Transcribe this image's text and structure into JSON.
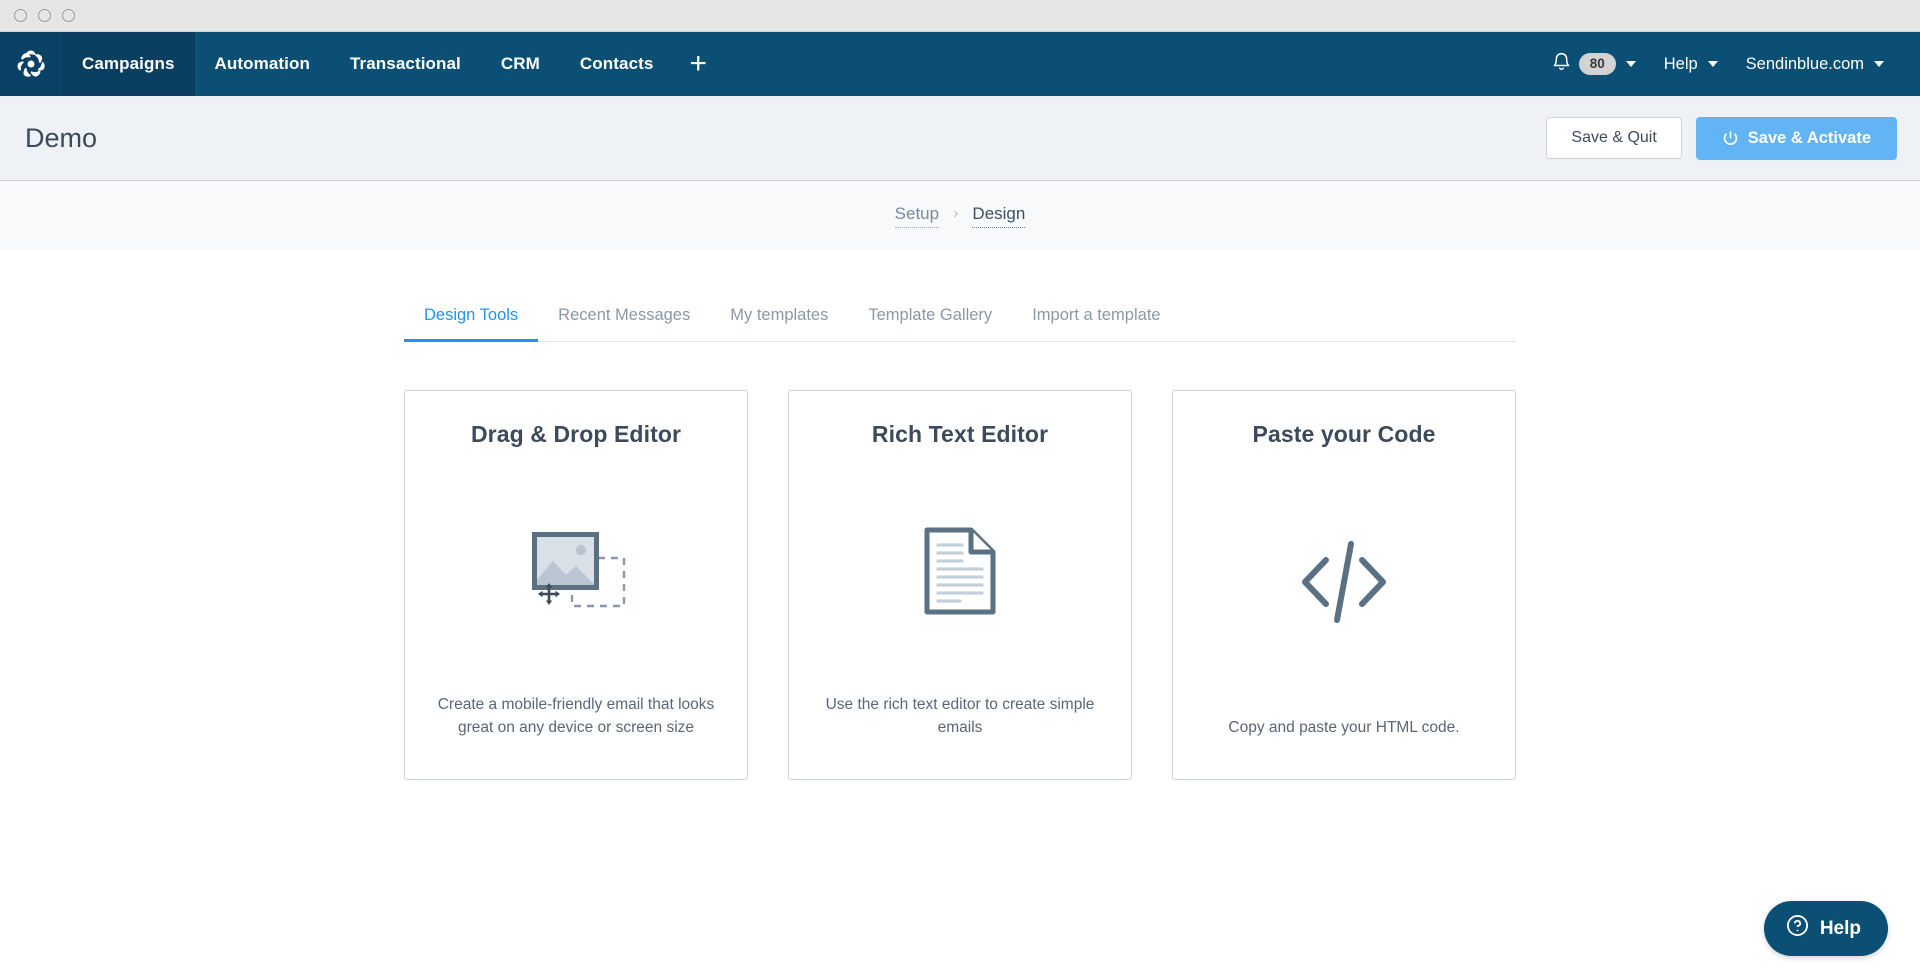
{
  "window": {
    "dots": [
      "close-dot",
      "minimize-dot",
      "maximize-dot"
    ]
  },
  "navbar": {
    "logo_name": "sendinblue-logo",
    "items": [
      {
        "label": "Campaigns",
        "active": true
      },
      {
        "label": "Automation",
        "active": false
      },
      {
        "label": "Transactional",
        "active": false
      },
      {
        "label": "CRM",
        "active": false
      },
      {
        "label": "Contacts",
        "active": false
      }
    ],
    "add_label": "+",
    "notifications": {
      "icon": "bell-icon",
      "count": "80"
    },
    "help_label": "Help",
    "account_label": "Sendinblue.com",
    "bg_color": "#0b4f74",
    "active_bg_color": "#0a3f61"
  },
  "subheader": {
    "title": "Demo",
    "save_quit_label": "Save & Quit",
    "save_activate_label": "Save & Activate",
    "primary_color": "#62b4f5"
  },
  "breadcrumb": {
    "items": [
      {
        "label": "Setup",
        "current": false
      },
      {
        "label": "Design",
        "current": true
      }
    ],
    "separator": "›"
  },
  "tabs": [
    {
      "label": "Design Tools",
      "active": true
    },
    {
      "label": "Recent Messages",
      "active": false
    },
    {
      "label": "My templates",
      "active": false
    },
    {
      "label": "Template Gallery",
      "active": false
    },
    {
      "label": "Import a template",
      "active": false
    }
  ],
  "tab_accent_color": "#1e93f7",
  "cards": [
    {
      "title": "Drag & Drop Editor",
      "description": "Create a mobile-friendly email that looks great on any device or screen size",
      "icon": "drag-drop-image-icon"
    },
    {
      "title": "Rich Text Editor",
      "description": "Use the rich text editor to create simple emails",
      "icon": "document-icon"
    },
    {
      "title": "Paste your Code",
      "description": "Copy and paste your HTML code.",
      "icon": "code-brackets-icon"
    }
  ],
  "help_widget": {
    "label": "Help",
    "icon": "question-circle-icon",
    "color": "#0b4f74"
  }
}
